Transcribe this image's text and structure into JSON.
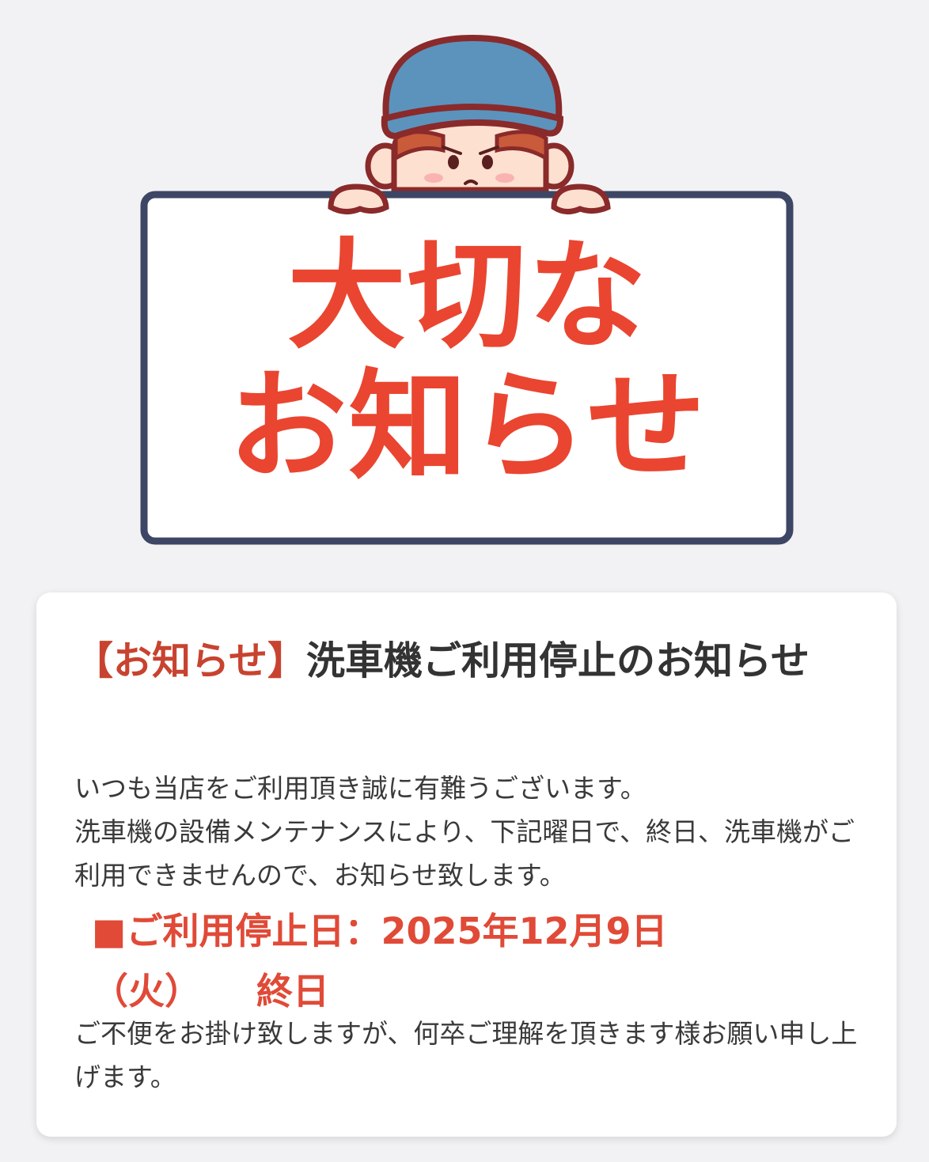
{
  "hero": {
    "sign_line1": "大切な",
    "sign_line2": "お知らせ",
    "icon": "worker-holding-sign-illustration",
    "colors": {
      "sign_text": "#ea4530",
      "sign_border": "#3d4665",
      "cap": "#5b93bd",
      "outline": "#8a2a2a",
      "skin": "#fde0d0",
      "hair": "#c95a3a"
    }
  },
  "notice": {
    "tag": "【お知らせ】",
    "title": "洗車機ご利用停止のお知らせ",
    "intro": "いつも当店をご利用頂き誠に有難うございます。\n洗車機の設備メンテナンスにより、下記曜日で、終日、洗車機がご利用できませんので、お知らせ致します。",
    "stop_label": "■ご利用停止日：2025年12月9日",
    "stop_weekday": "（火）",
    "stop_duration": "終日",
    "closing": "ご不便をお掛け致しますが、何卒ご理解を頂きます様お願い申し上げます。",
    "colors": {
      "accent": "#e04a37",
      "text": "#3a3a3a",
      "card_bg": "#ffffff",
      "page_bg": "#f2f2f4"
    }
  }
}
